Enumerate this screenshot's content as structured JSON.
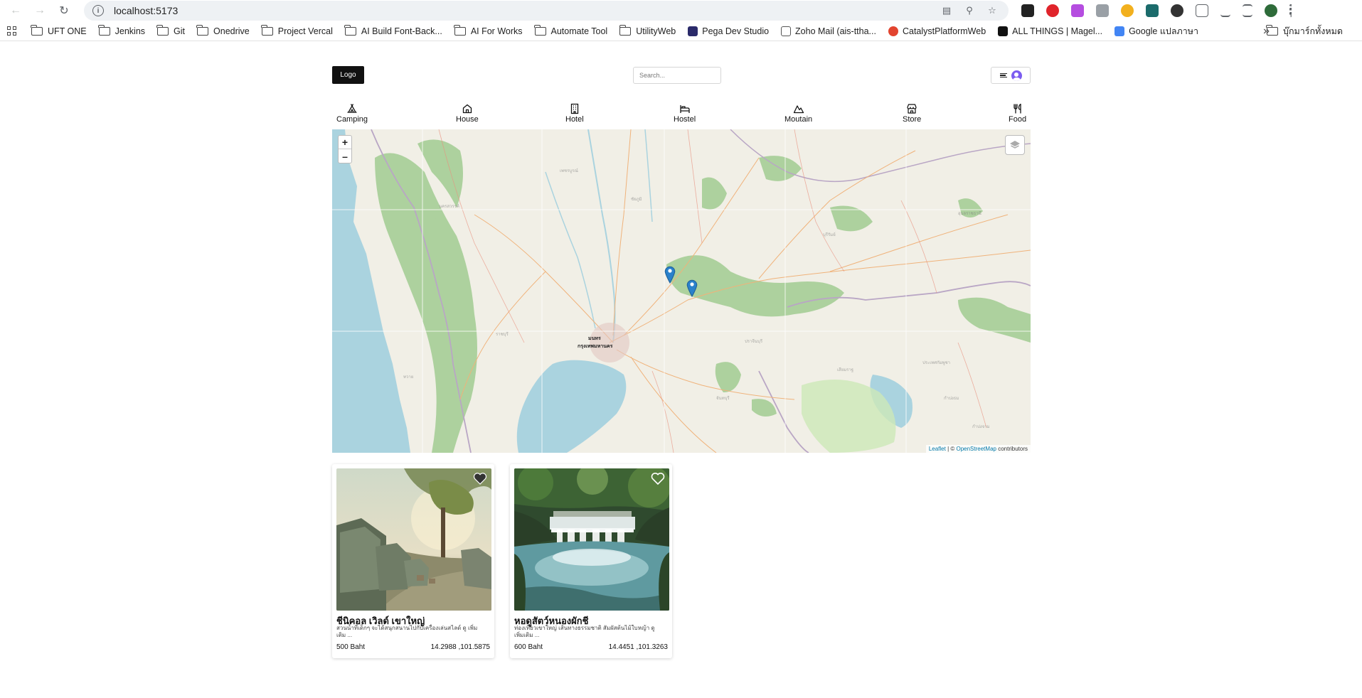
{
  "browser": {
    "url": "localhost:5173",
    "bookmarks": [
      {
        "label": "UFT ONE",
        "type": "folder"
      },
      {
        "label": "Jenkins",
        "type": "folder"
      },
      {
        "label": "Git",
        "type": "folder"
      },
      {
        "label": "Onedrive",
        "type": "folder"
      },
      {
        "label": "Project Vercal",
        "type": "folder"
      },
      {
        "label": "AI Build Font-Back...",
        "type": "folder"
      },
      {
        "label": "AI For Works",
        "type": "folder"
      },
      {
        "label": "Automate Tool",
        "type": "folder"
      },
      {
        "label": "UtilityWeb",
        "type": "folder"
      },
      {
        "label": "Pega Dev Studio",
        "type": "site"
      },
      {
        "label": "Zoho Mail (ais-ttha...",
        "type": "site"
      },
      {
        "label": "CatalystPlatformWeb",
        "type": "site"
      },
      {
        "label": "ALL THINGS | Magel...",
        "type": "site"
      },
      {
        "label": "Google แปลภาษา",
        "type": "site"
      }
    ],
    "all_bookmarks": "บุ๊กมาร์กทั้งหมด"
  },
  "header": {
    "logo": "Logo",
    "search_placeholder": "Search..."
  },
  "categories": [
    {
      "label": "Camping",
      "icon": "tent-icon"
    },
    {
      "label": "House",
      "icon": "house-icon"
    },
    {
      "label": "Hotel",
      "icon": "hotel-icon"
    },
    {
      "label": "Hostel",
      "icon": "bed-icon"
    },
    {
      "label": "Moutain",
      "icon": "mountain-icon"
    },
    {
      "label": "Store",
      "icon": "store-icon"
    },
    {
      "label": "Food",
      "icon": "utensils-icon"
    }
  ],
  "map": {
    "labels": {
      "bangkok_th": "กรุงเทพมหานคร",
      "bangkok_short": "มนทร"
    },
    "attribution": {
      "leaflet": "Leaflet",
      "separator": " | © ",
      "osm": "OpenStreetMap",
      "suffix": " contributors"
    }
  },
  "listings": [
    {
      "title": "ชีนิคอล เวิลด์ เขาใหญ่",
      "description": "สวนน้ำที่เด็กๆ จะได้สนุกสนานไปกับเครื่องเล่นสไลด์ ดู เพิ่มเติม ...",
      "price": "500 Baht",
      "coords": "14.2988 ,101.5875",
      "favorited": true
    },
    {
      "title": "หอดูสัตว์หนองผักชี",
      "description": "ท่องเที่ยวเขาใหญ่ เส้นทางธรรมชาติ สัมผัสต้นไม้ใบหญ้า ดู เพิ่มเติม ...",
      "price": "600 Baht",
      "coords": "14.4451 ,101.3263",
      "favorited": false
    }
  ]
}
